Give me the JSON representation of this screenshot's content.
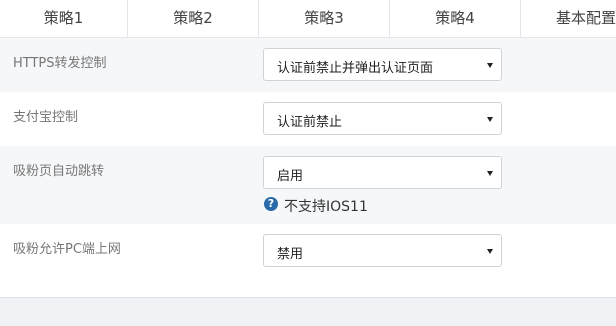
{
  "tabs": [
    {
      "label": "策略1"
    },
    {
      "label": "策略2"
    },
    {
      "label": "策略3"
    },
    {
      "label": "策略4"
    },
    {
      "label": "基本配置"
    }
  ],
  "settings": [
    {
      "label": "HTTPS转发控制",
      "value": "认证前禁止并弹出认证页面"
    },
    {
      "label": "支付宝控制",
      "value": "认证前禁止"
    },
    {
      "label": "吸粉页自动跳转",
      "value": "启用",
      "hint": "不支持IOS11",
      "hint_icon": "question-circle-icon"
    },
    {
      "label": "吸粉允许PC端上网",
      "value": "禁用"
    }
  ],
  "colors": {
    "page_background": "#f0f2f5",
    "panel_background": "#ffffff",
    "alt_row": "#f6f7f9",
    "border": "#cfd4da",
    "hint_icon": "#2a6aa8"
  }
}
